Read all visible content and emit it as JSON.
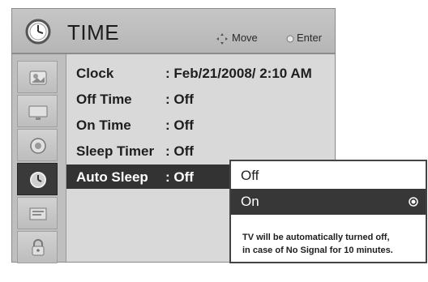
{
  "header": {
    "title": "TIME",
    "icon": "clock-icon",
    "hints": {
      "move": "Move",
      "enter": "Enter"
    }
  },
  "sidebar": {
    "items": [
      {
        "icon": "picture-icon"
      },
      {
        "icon": "screen-icon"
      },
      {
        "icon": "speaker-icon"
      },
      {
        "icon": "clock-icon",
        "active": true
      },
      {
        "icon": "option-icon"
      },
      {
        "icon": "lock-icon"
      }
    ]
  },
  "menu": {
    "rows": [
      {
        "label": "Clock",
        "value": ": Feb/21/2008/  2:10 AM"
      },
      {
        "label": "Off Time",
        "value": ": Off"
      },
      {
        "label": "On Time",
        "value": ": Off"
      },
      {
        "label": "Sleep Timer",
        "value": ": Off"
      },
      {
        "label": "Auto Sleep",
        "value": ": Off",
        "selected": true
      }
    ]
  },
  "popup": {
    "options": [
      {
        "label": "Off"
      },
      {
        "label": "On",
        "selected": true
      }
    ],
    "message_line1": "TV will be automatically turned off,",
    "message_line2": "in case of No Signal for 10 minutes."
  },
  "colors": {
    "panel": "#cfcfcf",
    "highlight": "#333333",
    "text": "#1e1e1e"
  }
}
